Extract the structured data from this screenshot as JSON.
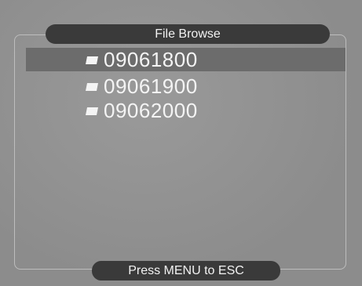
{
  "header": {
    "title": "File Browse"
  },
  "file_list": {
    "selected_index": 0,
    "items": [
      {
        "icon": "folder-icon",
        "label": "09061800"
      },
      {
        "icon": "folder-icon",
        "label": "09061900"
      },
      {
        "icon": "folder-icon",
        "label": "09062000"
      }
    ]
  },
  "footer": {
    "hint": "Press MENU to ESC"
  },
  "colors": {
    "background": "#8c8c8c",
    "pill": "#3a3a3a",
    "selection": "#6c6c6c",
    "text": "#f4f4f4"
  }
}
